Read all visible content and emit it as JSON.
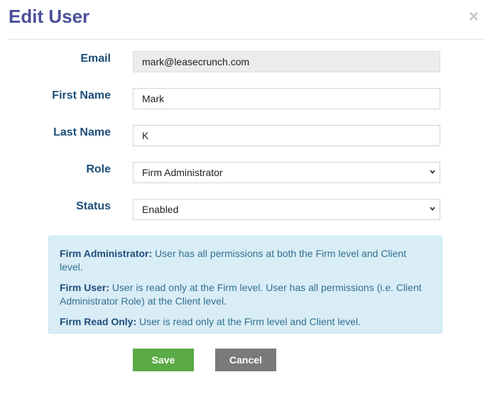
{
  "modal": {
    "title": "Edit User",
    "close_symbol": "×"
  },
  "form": {
    "email": {
      "label": "Email",
      "value": "mark@leasecrunch.com"
    },
    "first_name": {
      "label": "First Name",
      "value": "Mark"
    },
    "last_name": {
      "label": "Last Name",
      "value": "K"
    },
    "role": {
      "label": "Role",
      "value": "Firm Administrator"
    },
    "status": {
      "label": "Status",
      "value": "Enabled"
    }
  },
  "info": {
    "items": [
      {
        "term": "Firm Administrator:",
        "desc": " User has all permissions at both the Firm level and Client level."
      },
      {
        "term": "Firm User:",
        "desc": " User is read only at the Firm level. User has all permissions (i.e. Client Administrator Role) at the Client level."
      },
      {
        "term": "Firm Read Only:",
        "desc": " User is read only at the Firm level and Client level."
      }
    ]
  },
  "buttons": {
    "save_label": "Save",
    "cancel_label": "Cancel"
  },
  "colors": {
    "title": "#4a4f9a",
    "label": "#1e4e79",
    "save": "#5aaa46",
    "cancel": "#7a7a7a",
    "info_bg": "#d9edf7"
  }
}
